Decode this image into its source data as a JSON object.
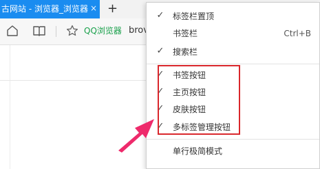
{
  "tab": {
    "title": "古网站 - 浏览器_浏览器",
    "close_glyph": "×",
    "new_tab_glyph": "+"
  },
  "toolbar": {
    "buttons": [
      {
        "name": "home-icon"
      },
      {
        "name": "reading-mode-icon"
      },
      {
        "name": "star-icon"
      }
    ],
    "bookmarks": [
      {
        "label": "QQ浏览器",
        "color": "#19a04b"
      },
      {
        "label": "brov"
      }
    ]
  },
  "menu": {
    "items": [
      {
        "label": "标签栏置顶",
        "checked": true,
        "check_glyph": "✓",
        "shortcut": ""
      },
      {
        "label": "书签栏",
        "checked": false,
        "check_glyph": "",
        "shortcut": "Ctrl+B"
      },
      {
        "label": "搜索栏",
        "checked": true,
        "check_glyph": "✓",
        "shortcut": ""
      },
      {
        "label": "书签按钮",
        "checked": true,
        "check_glyph": "✓",
        "shortcut": ""
      },
      {
        "label": "主页按钮",
        "checked": true,
        "check_glyph": "✓",
        "shortcut": ""
      },
      {
        "label": "皮肤按钮",
        "checked": true,
        "check_glyph": "✓",
        "shortcut": ""
      },
      {
        "label": "多标签管理按钮",
        "checked": true,
        "check_glyph": "✓",
        "shortcut": ""
      },
      {
        "label": "单行极简模式",
        "checked": false,
        "check_glyph": "",
        "shortcut": ""
      }
    ]
  },
  "annotation": {
    "highlight_color": "#d9262b",
    "arrow_color": "#ee2a6b"
  },
  "colors": {
    "tab_active": "#1a8cf0",
    "qq_green": "#19a04b"
  }
}
